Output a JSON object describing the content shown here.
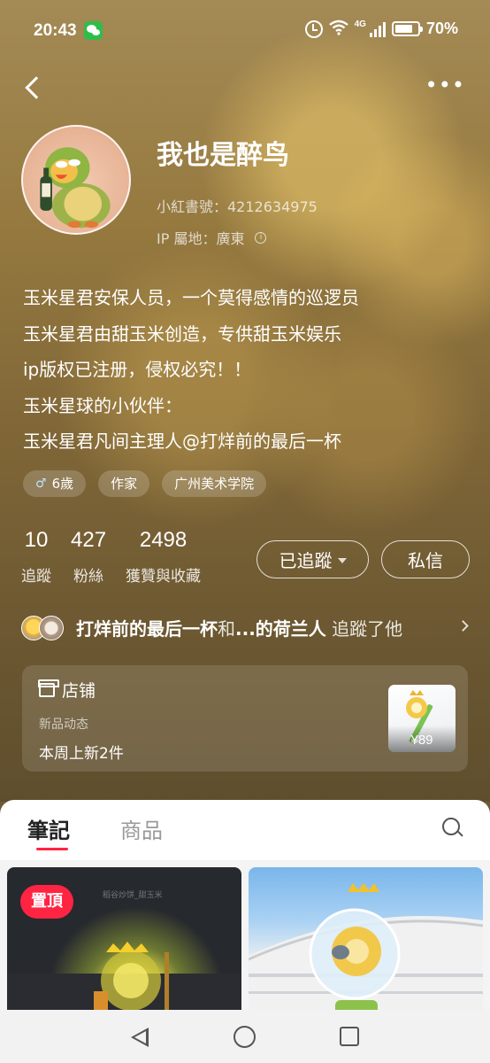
{
  "status_bar": {
    "time": "20:43",
    "network": "4G",
    "battery": "70%"
  },
  "profile": {
    "name": "我也是醉鸟",
    "id_text": "小紅書號：4212634975",
    "ip_text": "IP 屬地：廣東",
    "bio": "玉米星君安保人员，一个莫得感情的巡逻员\n玉米星君由甜玉米创造，专供甜玉米娱乐\nip版权已注册，侵权必究！！\n玉米星球的小伙伴：\n玉米星君凡间主理人@打烊前的最后一杯",
    "tags": [
      "6歲",
      "作家",
      "广州美术学院"
    ]
  },
  "stats": [
    {
      "num": "10",
      "label": "追蹤"
    },
    {
      "num": "427",
      "label": "粉絲"
    },
    {
      "num": "2498",
      "label": "獲贊與收藏"
    }
  ],
  "actions": {
    "follow_label": "已追蹤",
    "message_label": "私信"
  },
  "mutual": {
    "name1": "打烊前的最后一杯",
    "joiner": "和",
    "name2": "...的荷兰人",
    "suffix": " 追蹤了他"
  },
  "shop": {
    "title": "店铺",
    "subtitle": "新品动态",
    "new_items": "本周上新2件",
    "price": "¥89"
  },
  "tabs": {
    "notes": "筆記",
    "goods": "商品"
  },
  "feed": {
    "pinned_label": "置頂",
    "watermark": "稻谷炒饼_甜玉米"
  },
  "colors": {
    "accent": "#ff2442",
    "header_bg": "#7f6637",
    "wechat": "#2fbd4a"
  },
  "icons": [
    "wechat-icon",
    "alarm-icon",
    "wifi-icon",
    "signal-icon",
    "battery-icon",
    "back-icon",
    "more-icon",
    "info-icon",
    "gender-icon",
    "caret-down-icon",
    "chevron-right-icon",
    "store-icon",
    "search-icon",
    "nav-back-icon",
    "nav-home-icon",
    "nav-recent-icon"
  ]
}
